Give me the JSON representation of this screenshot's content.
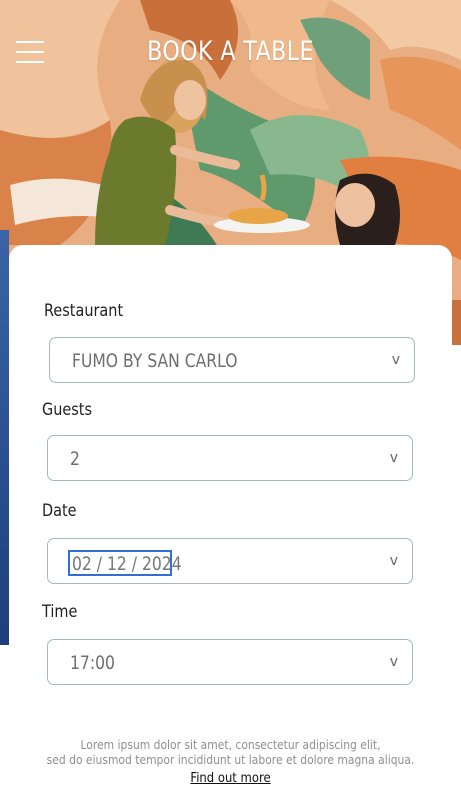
{
  "header": {
    "title": "BOOK A TABLE",
    "menu_icon": "hamburger-menu-icon"
  },
  "form": {
    "restaurant": {
      "label": "Restaurant",
      "value": "FUMO BY SAN CARLO"
    },
    "guests": {
      "label": "Guests",
      "value": "2"
    },
    "date": {
      "label": "Date",
      "value": "02 / 12 / 2024"
    },
    "time": {
      "label": "Time",
      "value": "17:00"
    },
    "chevron": "v"
  },
  "footer": {
    "text_line1": "Lorem ipsum dolor sit amet, consectetur adipiscing elit,",
    "text_line2": "sed do eiusmod tempor incididunt ut labore et dolore  magna aliqua.",
    "link": "Find out more"
  },
  "colors": {
    "field_border": "#9fbcb8",
    "date_focus": "#2f6fd6",
    "title": "#ffffff"
  }
}
